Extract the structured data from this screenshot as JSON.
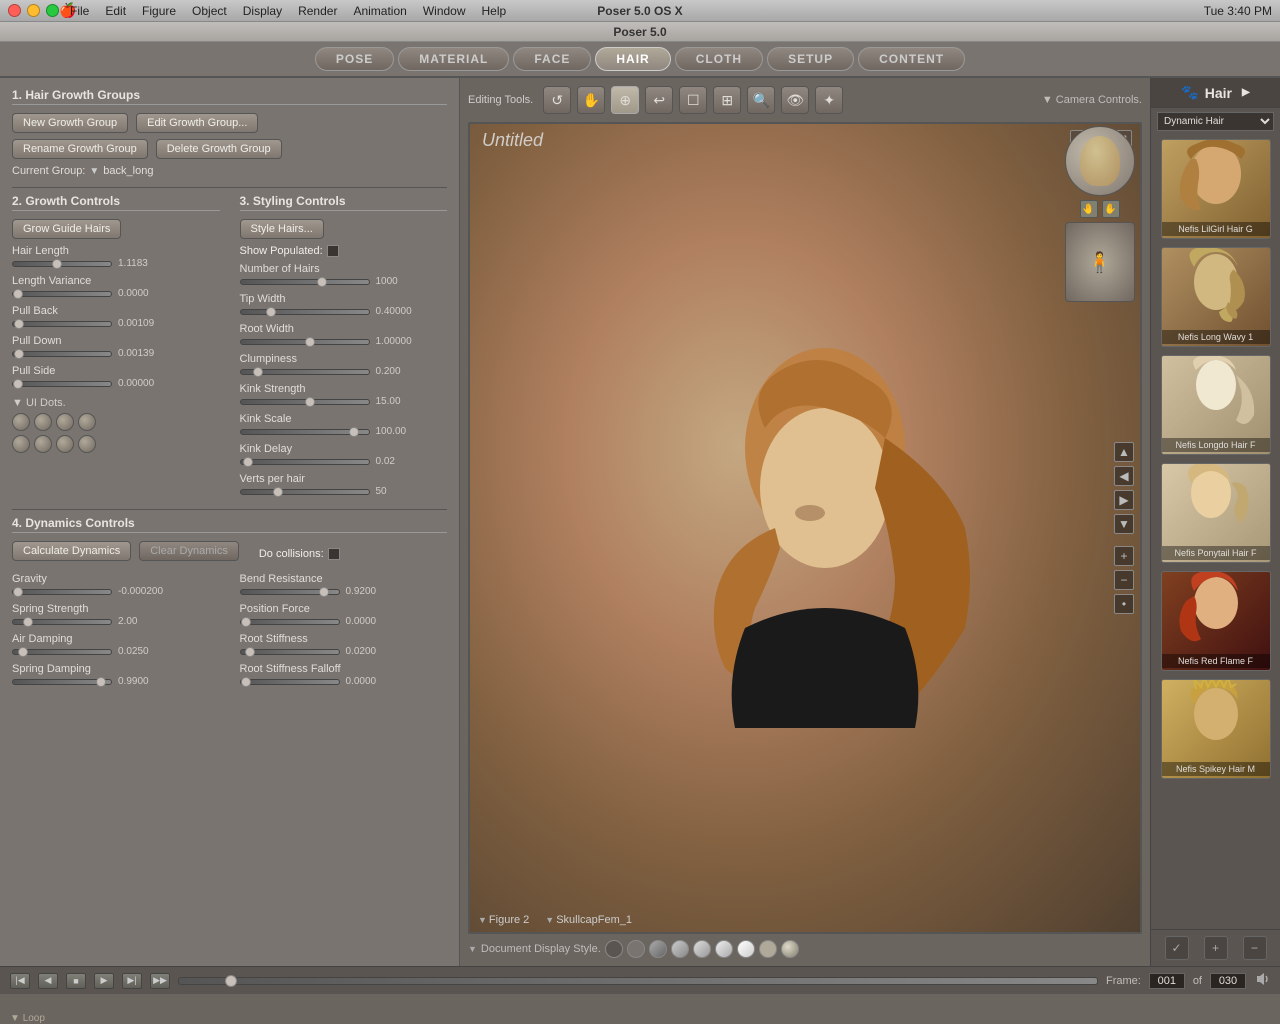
{
  "app": {
    "title": "Poser 5.0",
    "os": "Poser 5.0 OS X",
    "time": "Tue 3:40 PM"
  },
  "menubar": {
    "items": [
      "File",
      "Edit",
      "Figure",
      "Object",
      "Display",
      "Render",
      "Animation",
      "Window",
      "Help"
    ]
  },
  "tabs": {
    "items": [
      "POSE",
      "MATERIAL",
      "FACE",
      "HAIR",
      "CLOTH",
      "SETUP",
      "CONTENT"
    ],
    "active": "HAIR"
  },
  "hair_growth": {
    "section_title": "1. Hair Growth Groups",
    "new_group_btn": "New Growth Group",
    "edit_group_btn": "Edit Growth Group...",
    "rename_btn": "Rename Growth Group",
    "delete_btn": "Delete Growth Group",
    "current_group_label": "Current Group:",
    "current_group_value": "back_long"
  },
  "growth_controls": {
    "section_title": "2. Growth Controls",
    "grow_guide_btn": "Grow Guide Hairs",
    "hair_length_label": "Hair Length",
    "hair_length_value": "1.1183",
    "length_variance_label": "Length Variance",
    "length_variance_value": "0.0000",
    "pull_back_label": "Pull Back",
    "pull_back_value": "0.00109",
    "pull_down_label": "Pull Down",
    "pull_down_value": "0.00139",
    "pull_side_label": "Pull Side",
    "pull_side_value": "0.00000"
  },
  "styling_controls": {
    "section_title": "3. Styling Controls",
    "style_hairs_btn": "Style Hairs...",
    "show_populated_label": "Show Populated:",
    "number_of_hairs_label": "Number of Hairs",
    "number_of_hairs_value": "1000",
    "tip_width_label": "Tip Width",
    "tip_width_value": "0.40000",
    "root_width_label": "Root Width",
    "root_width_value": "1.00000",
    "clumpiness_label": "Clumpiness",
    "clumpiness_value": "0.200",
    "kink_strength_label": "Kink Strength",
    "kink_strength_value": "15.00",
    "kink_scale_label": "Kink Scale",
    "kink_scale_value": "100.00",
    "kink_delay_label": "Kink Delay",
    "kink_delay_value": "0.02",
    "verts_per_hair_label": "Verts per hair",
    "verts_per_hair_value": "50"
  },
  "dynamics_controls": {
    "section_title": "4. Dynamics Controls",
    "do_collisions_label": "Do collisions:",
    "calculate_btn": "Calculate Dynamics",
    "clear_btn": "Clear Dynamics",
    "gravity_label": "Gravity",
    "gravity_value": "-0.000200",
    "spring_strength_label": "Spring Strength",
    "spring_strength_value": "2.00",
    "air_damping_label": "Air Damping",
    "air_damping_value": "0.0250",
    "spring_damping_label": "Spring Damping",
    "spring_damping_value": "0.9900",
    "bend_resistance_label": "Bend Resistance",
    "bend_resistance_value": "0.9200",
    "position_force_label": "Position Force",
    "position_force_value": "0.0000",
    "root_stiffness_label": "Root Stiffness",
    "root_stiffness_value": "0.0200",
    "root_stiffness_falloff_label": "Root Stiffness Falloff",
    "root_stiffness_falloff_value": "0.0000"
  },
  "ui_dots": {
    "label": "UI Dots.",
    "section_arrow": "▼"
  },
  "viewport": {
    "title": "Untitled",
    "figure_label": "Figure 2",
    "figure_arrow": "▼",
    "skullcap_label": "SkullcapFem_1",
    "skullcap_arrow": "▼"
  },
  "editing_tools": {
    "label": "Editing Tools.",
    "tools": [
      "↺",
      "✋",
      "⊕",
      "↩",
      "☐",
      "⊞",
      "🔍",
      "👁",
      "✦"
    ]
  },
  "camera_controls": {
    "label": "Camera Controls.",
    "arrow": "▼"
  },
  "display_style": {
    "label": "Document Display Style."
  },
  "right_panel": {
    "title": "Hair",
    "hair_icon": "🐱",
    "dynamic_hair_label": "Dynamic Hair",
    "hair_items": [
      {
        "name": "Nefis LilGirl Hair G",
        "color": "#c0a060"
      },
      {
        "name": "Nefis Long Wavy 1",
        "color": "#a08040"
      },
      {
        "name": "Nefis Longdo Hair F",
        "color": "#d0c0a0"
      },
      {
        "name": "Nefis Ponytail Hair F",
        "color": "#d8c8a8"
      },
      {
        "name": "Nefis Red Flame F",
        "color": "#a04020"
      },
      {
        "name": "Nefis Spikey Hair M",
        "color": "#d0b060"
      }
    ]
  },
  "bottom_bar": {
    "frame_label": "Frame:",
    "current_frame": "001",
    "of_label": "of",
    "total_frames": "030",
    "loop_label": "Loop"
  }
}
